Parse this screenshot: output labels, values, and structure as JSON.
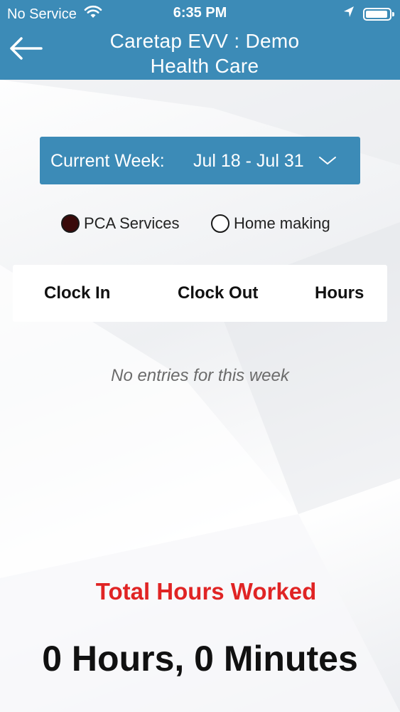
{
  "status_bar": {
    "carrier": "No Service",
    "time": "6:35 PM",
    "wifi_icon": "wifi-icon",
    "location_icon": "location-arrow-icon",
    "battery_icon": "battery-icon",
    "battery_level": 0.95
  },
  "nav": {
    "back_icon": "back-arrow-icon",
    "title_line1": "Caretap EVV : Demo",
    "title_line2": "Health Care"
  },
  "week": {
    "label": "Current Week:",
    "range": "Jul 18 - Jul 31",
    "chevron_icon": "chevron-down-icon"
  },
  "service_types": [
    {
      "label": "PCA Services",
      "selected": true
    },
    {
      "label": "Home making",
      "selected": false
    }
  ],
  "table": {
    "columns": [
      "Clock In",
      "Clock Out",
      "Hours"
    ],
    "rows": [],
    "empty_message": "No entries for this week"
  },
  "summary": {
    "label": "Total Hours Worked",
    "value": "0 Hours, 0 Minutes"
  },
  "colors": {
    "header_bg": "#3c8bb7",
    "total_label": "#e02424",
    "selected_radio": "#3a0a0a"
  }
}
